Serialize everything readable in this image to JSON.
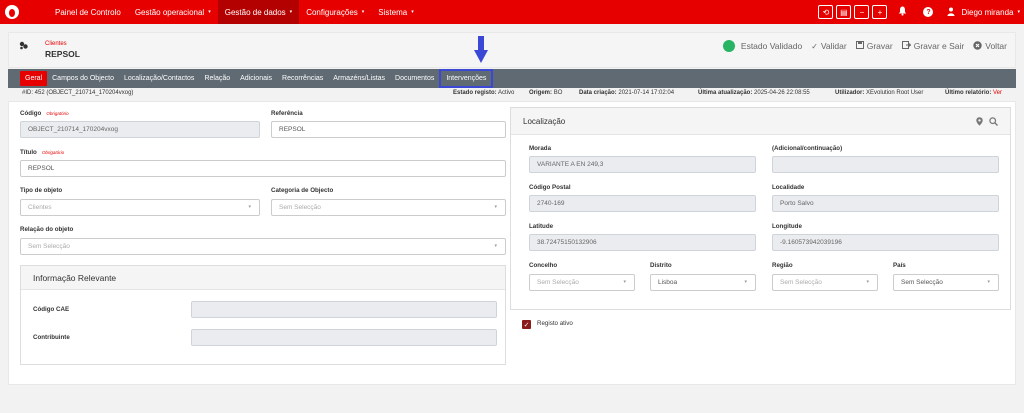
{
  "topbar": {
    "nav": [
      {
        "label": "Painel de Controlo",
        "caret": false,
        "active": false
      },
      {
        "label": "Gestão operacional",
        "caret": true,
        "active": false
      },
      {
        "label": "Gestão de dados",
        "caret": true,
        "active": true
      },
      {
        "label": "Configurações",
        "caret": true,
        "active": false
      },
      {
        "label": "Sistema",
        "caret": true,
        "active": false
      }
    ],
    "buttons": [
      "⟲",
      "▤",
      "−",
      "+"
    ],
    "user_name": "Diego miranda",
    "caret_glyph": "▾"
  },
  "header": {
    "entity_type": "Clientes",
    "entity_name": "REPSOL",
    "status_label": "Estado Validado",
    "actions": {
      "validate": "Validar",
      "save": "Gravar",
      "save_exit": "Gravar e Sair",
      "back": "Voltar"
    }
  },
  "tabs": [
    {
      "label": "Geral",
      "active": true
    },
    {
      "label": "Campos do Objecto"
    },
    {
      "label": "Localização/Contactos"
    },
    {
      "label": "Relação"
    },
    {
      "label": "Adicionais"
    },
    {
      "label": "Recorrências"
    },
    {
      "label": "Armazéns/Listas"
    },
    {
      "label": "Documentos"
    },
    {
      "label": "Intervenções",
      "highlight": true
    }
  ],
  "info": {
    "id": "#ID: 452 (OBJECT_210714_170204vxog)",
    "estado_label": "Estado registo:",
    "estado_value": "Activo",
    "origem_label": "Origem:",
    "origem_value": "BO",
    "criacao_label": "Data criação:",
    "criacao_value": "2021-07-14 17:02:04",
    "atualizacao_label": "Última atualização:",
    "atualizacao_value": "2025-04-26 22:08:55",
    "utilizador_label": "Utilizador:",
    "utilizador_value": "XEvolution Root User",
    "relatorio_label": "Último relatório:",
    "relatorio_value": "Ver"
  },
  "form": {
    "codigo_label": "Código",
    "required_label": "Obrigatório",
    "codigo_value": "OBJECT_210714_170204vxog",
    "referencia_label": "Referência",
    "referencia_value": "REPSOL",
    "titulo_label": "Título",
    "titulo_value": "REPSOL",
    "tipo_label": "Tipo de objeto",
    "tipo_value": "Clientes",
    "categoria_label": "Categoria de Objecto",
    "categoria_value": "Sem Selecção",
    "relacao_label": "Relação do objeto",
    "relacao_value": "Sem Selecção",
    "info_title": "Informação Relevante",
    "cae_label": "Código CAE",
    "cae_value": "",
    "contribuinte_label": "Contribuinte",
    "contribuinte_value": ""
  },
  "location": {
    "title": "Localização",
    "morada_label": "Morada",
    "morada_value": "VARIANTE A EN 249,3",
    "adicional_label": "(Adicional/continuação)",
    "adicional_value": "",
    "cp_label": "Código Postal",
    "cp_value": "2740-169",
    "localidade_label": "Localidade",
    "localidade_value": "Porto Salvo",
    "latitude_label": "Latitude",
    "latitude_value": "38.72475150132906",
    "longitude_label": "Longitude",
    "longitude_value": "-9.160573942039196",
    "concelho_label": "Concelho",
    "concelho_value": "Sem Selecção",
    "distrito_label": "Distrito",
    "distrito_value": "Lisboa",
    "regiao_label": "Região",
    "regiao_value": "Sem Selecção",
    "pais_label": "País",
    "pais_value": "Sem Selecção"
  },
  "registo_ativo_label": "Registo ativo",
  "colors": {
    "brand_red": "#e60000",
    "tab_bar": "#5f6a73",
    "status_green": "#28b463",
    "highlight_blue": "#3b48d6"
  }
}
